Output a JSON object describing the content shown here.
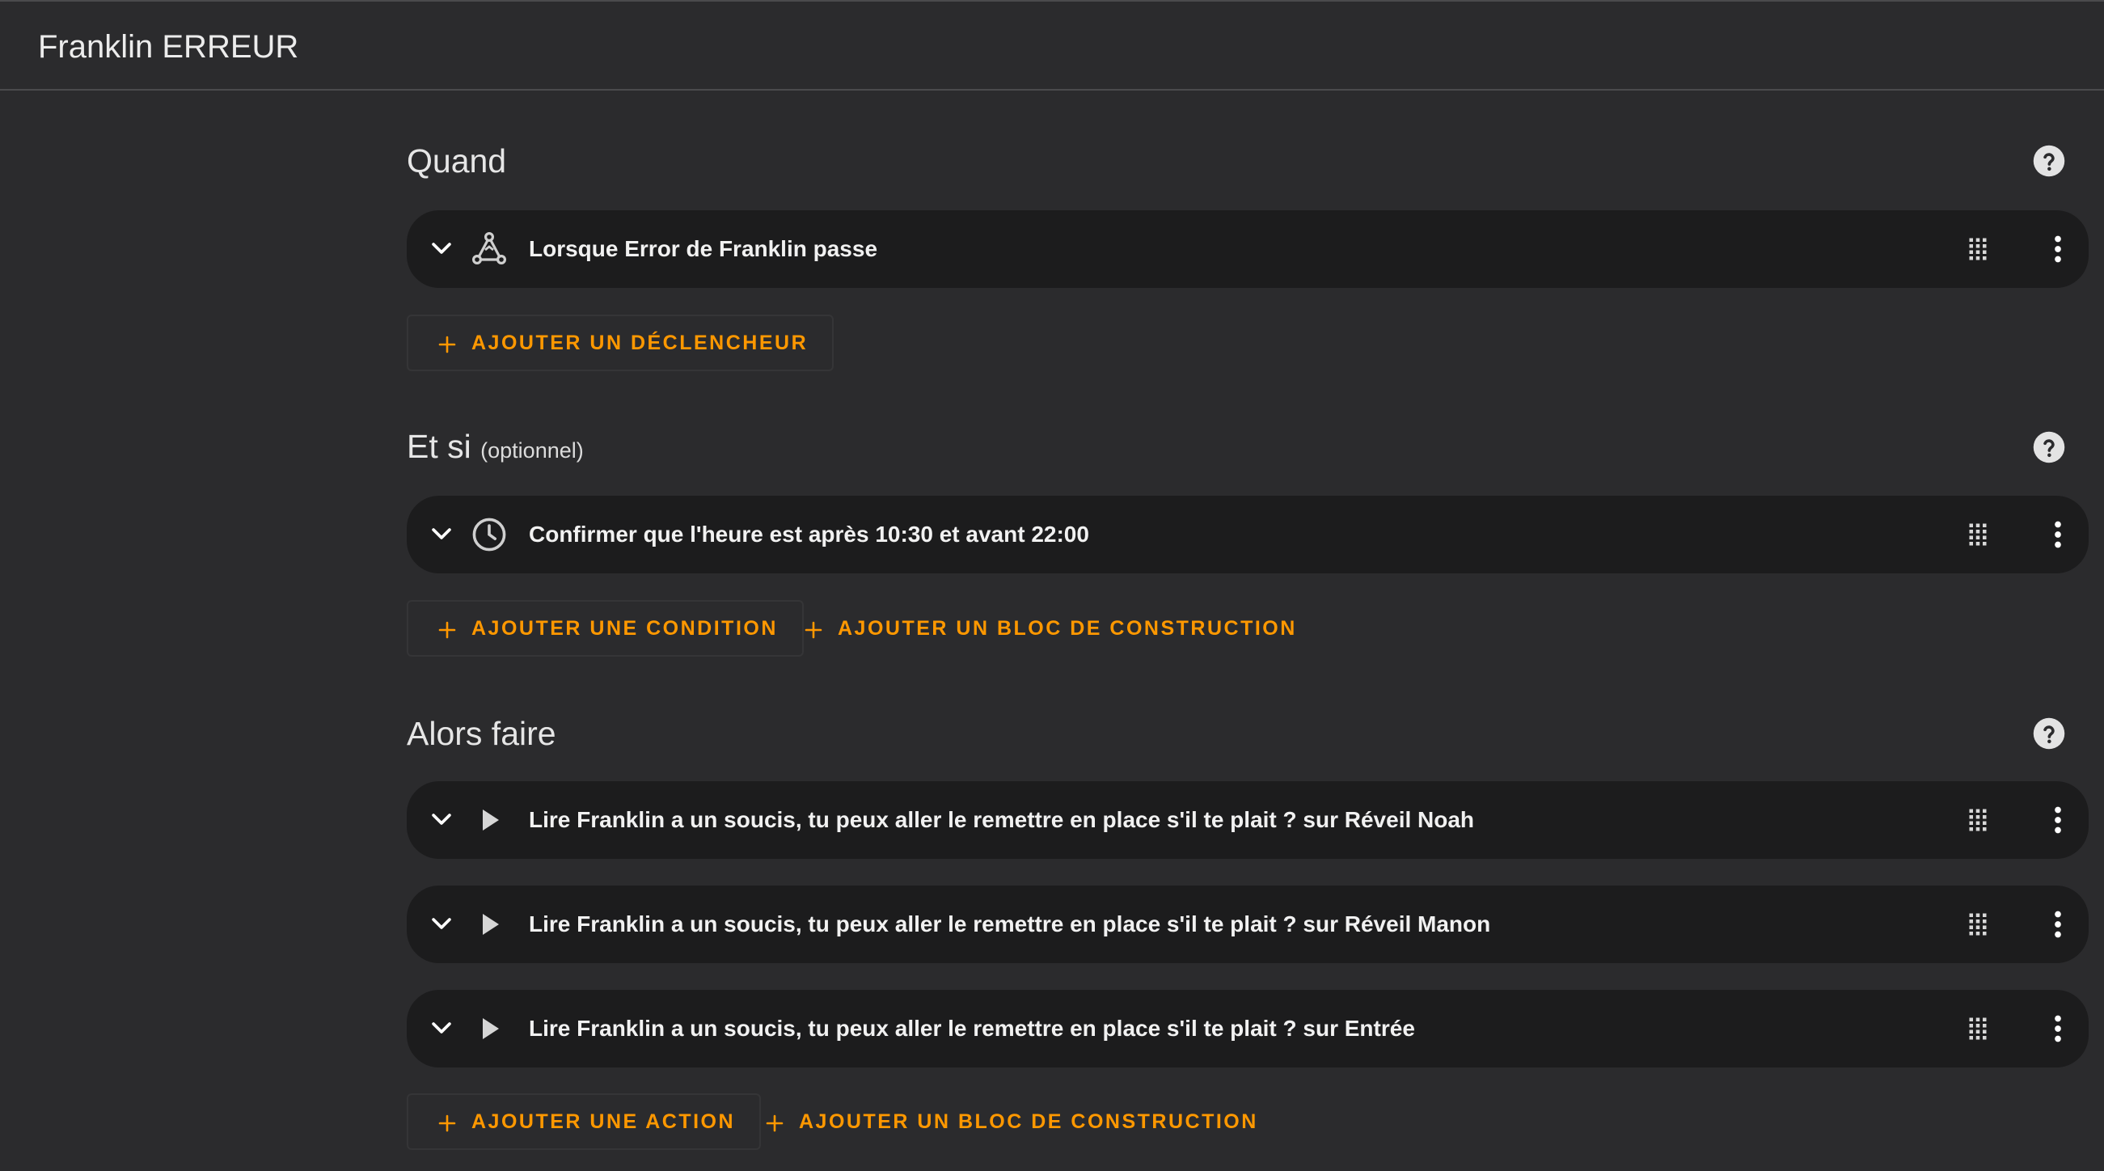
{
  "window": {
    "title": "Franklin ERREUR"
  },
  "sections": {
    "triggers": {
      "title": "Quand",
      "rows": [
        {
          "label": "Lorsque Error de Franklin passe",
          "icon": "network-trigger-icon"
        }
      ],
      "buttons": {
        "add_trigger": "AJOUTER UN DÉCLENCHEUR"
      }
    },
    "conditions": {
      "title": "Et si",
      "optional": "(optionnel)",
      "rows": [
        {
          "label": "Confirmer que l'heure est après 10:30 et avant 22:00",
          "icon": "clock-icon"
        }
      ],
      "buttons": {
        "add_condition": "AJOUTER UNE CONDITION",
        "add_building_block": "AJOUTER UN BLOC DE CONSTRUCTION"
      }
    },
    "actions": {
      "title": "Alors faire",
      "rows": [
        {
          "label": "Lire Franklin a un soucis, tu peux aller le remettre en place s'il te plait ? sur Réveil Noah",
          "icon": "play-icon"
        },
        {
          "label": "Lire Franklin a un soucis, tu peux aller le remettre en place s'il te plait ? sur Réveil Manon",
          "icon": "play-icon"
        },
        {
          "label": "Lire Franklin a un soucis, tu peux aller le remettre en place s'il te plait ? sur Entrée",
          "icon": "play-icon"
        }
      ],
      "buttons": {
        "add_action": "AJOUTER UNE ACTION",
        "add_building_block": "AJOUTER UN BLOC DE CONSTRUCTION"
      }
    }
  },
  "colors": {
    "background": "#2b2b2d",
    "row_background": "#1c1c1d",
    "accent": "#ff9800",
    "text": "#f1f1f1"
  }
}
